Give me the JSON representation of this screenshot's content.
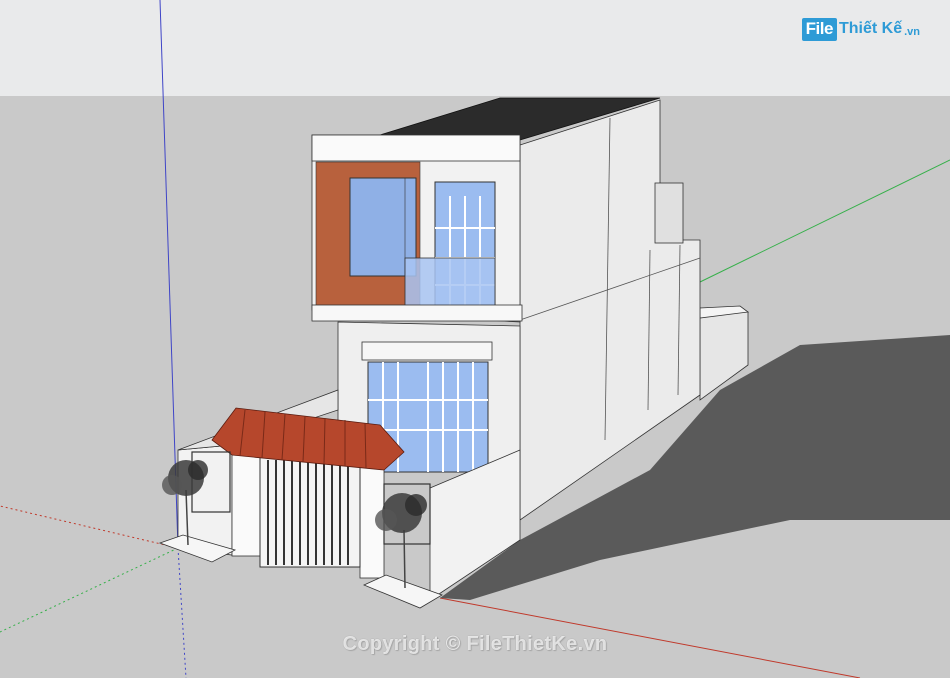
{
  "branding": {
    "logo_box_text": "File",
    "logo_text": "Thiết Kế",
    "logo_suffix": ".vn"
  },
  "watermark": {
    "text": "Copyright © FileThietKe.vn"
  },
  "colors": {
    "sky": "#e9eaeb",
    "ground": "#c9c9c9",
    "shadow": "#5a5a5a",
    "wall": "#efefef",
    "wall_shade": "#e2e2e2",
    "roof": "#2b2b2b",
    "brick": "#b8613d",
    "glass": "#8fb0e6",
    "tile_roof": "#b6472c",
    "axis_red": "#c0392b",
    "axis_green": "#36b04a",
    "axis_blue": "#3f45c7",
    "brand": "#2e9bd6"
  }
}
